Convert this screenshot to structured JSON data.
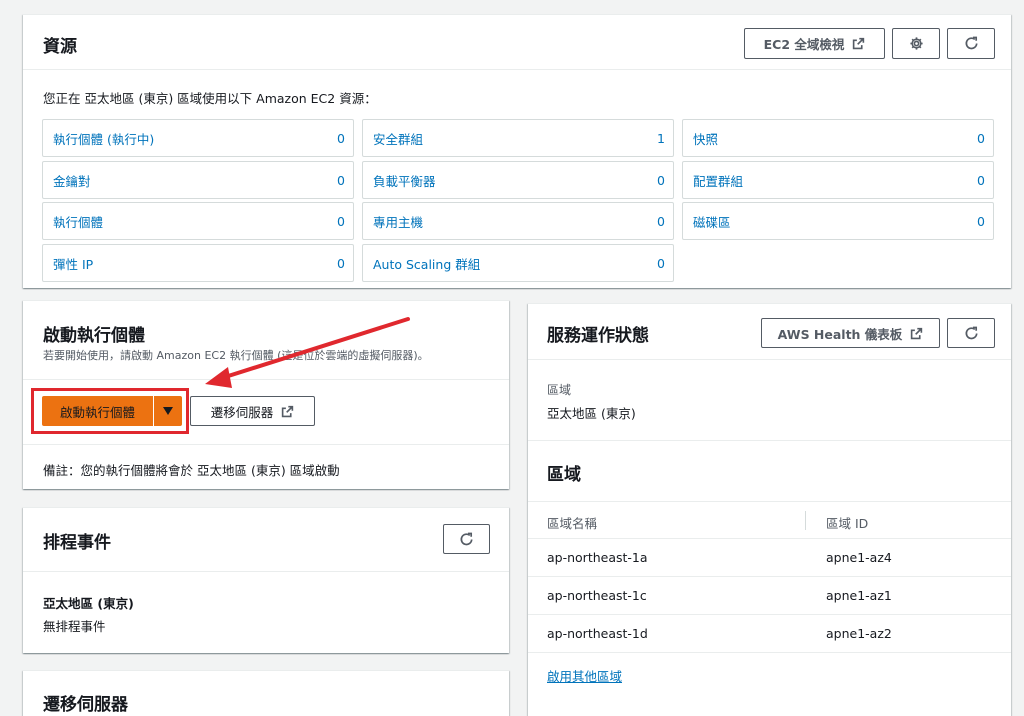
{
  "resources": {
    "title": "資源",
    "global_view_label": "EC2 全域檢視",
    "intro": "您正在 亞太地區 (東京) 區域使用以下 Amazon EC2 資源：",
    "items": [
      {
        "label": "執行個體 (執行中)",
        "count": "0"
      },
      {
        "label": "安全群組",
        "count": "1"
      },
      {
        "label": "快照",
        "count": "0"
      },
      {
        "label": "金鑰對",
        "count": "0"
      },
      {
        "label": "負載平衡器",
        "count": "0"
      },
      {
        "label": "配置群組",
        "count": "0"
      },
      {
        "label": "執行個體",
        "count": "0"
      },
      {
        "label": "專用主機",
        "count": "0"
      },
      {
        "label": "磁碟區",
        "count": "0"
      },
      {
        "label": "彈性 IP",
        "count": "0"
      },
      {
        "label": "Auto Scaling 群組",
        "count": "0"
      }
    ]
  },
  "launch": {
    "title": "啟動執行個體",
    "subtitle": "若要開始使用，請啟動 Amazon EC2 執行個體 (這是位於雲端的虛擬伺服器)。",
    "launch_button": "啟動執行個體",
    "migrate_button": "遷移伺服器",
    "note": "備註：您的執行個體將會於 亞太地區 (東京) 區域啟動"
  },
  "scheduled": {
    "title": "排程事件",
    "region": "亞太地區 (東京)",
    "status": "無排程事件"
  },
  "migrate": {
    "title": "遷移伺服器"
  },
  "health": {
    "title": "服務運作狀態",
    "dashboard_button": "AWS Health 儀表板",
    "region_label": "區域",
    "region_value": "亞太地區 (東京)"
  },
  "zones": {
    "title": "區域",
    "columns": [
      "區域名稱",
      "區域 ID"
    ],
    "rows": [
      [
        "ap-northeast-1a",
        "apne1-az4"
      ],
      [
        "ap-northeast-1c",
        "apne1-az1"
      ],
      [
        "ap-northeast-1d",
        "apne1-az2"
      ]
    ],
    "enable_link": "啟用其他區域"
  },
  "colors": {
    "primary_button": "#ec7211",
    "link": "#0073bb",
    "annotation": "#e0282e"
  }
}
